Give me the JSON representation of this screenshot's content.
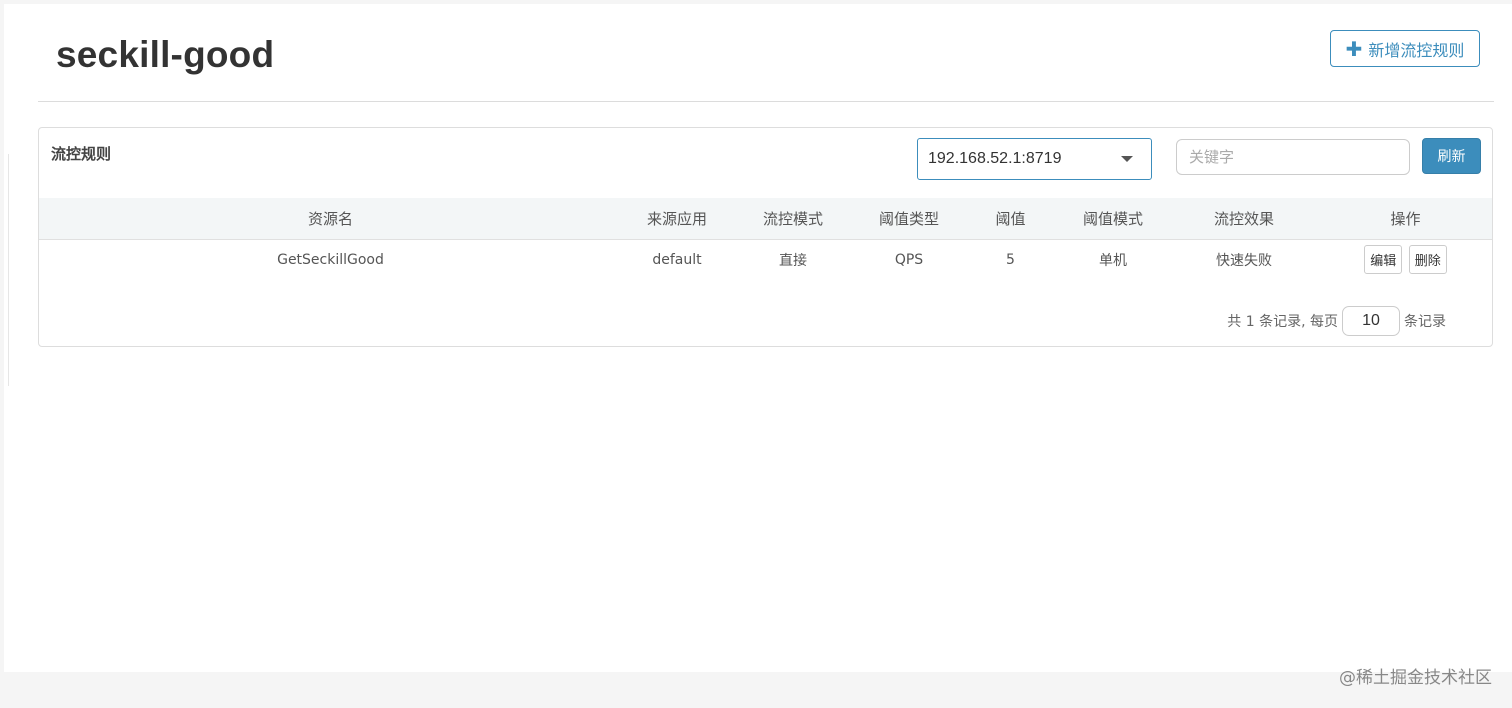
{
  "header": {
    "title": "seckill-good",
    "add_button": {
      "icon": "plus-icon",
      "label": "新增流控规则"
    }
  },
  "panel": {
    "title": "流控规则",
    "machine_select": {
      "value": "192.168.52.1:8719",
      "icon": "chevron-down-icon"
    },
    "keyword_input": {
      "placeholder": "关键字",
      "value": ""
    },
    "refresh_label": "刷新"
  },
  "table": {
    "columns": [
      "资源名",
      "来源应用",
      "流控模式",
      "阈值类型",
      "阈值",
      "阈值模式",
      "流控效果",
      "操作"
    ],
    "rows": [
      {
        "resource": "GetSeckillGood",
        "origin": "default",
        "mode": "直接",
        "threshold_type": "QPS",
        "threshold": "5",
        "cluster_mode": "单机",
        "effect": "快速失败",
        "edit_label": "编辑",
        "delete_label": "删除"
      }
    ]
  },
  "pagination": {
    "prefix": "共 1 条记录, 每页",
    "page_size": "10",
    "suffix": "条记录"
  },
  "watermark": "@稀土掘金技术社区",
  "colors": {
    "primary": "#3c8dbc",
    "header_bg": "#f3f6f7"
  }
}
